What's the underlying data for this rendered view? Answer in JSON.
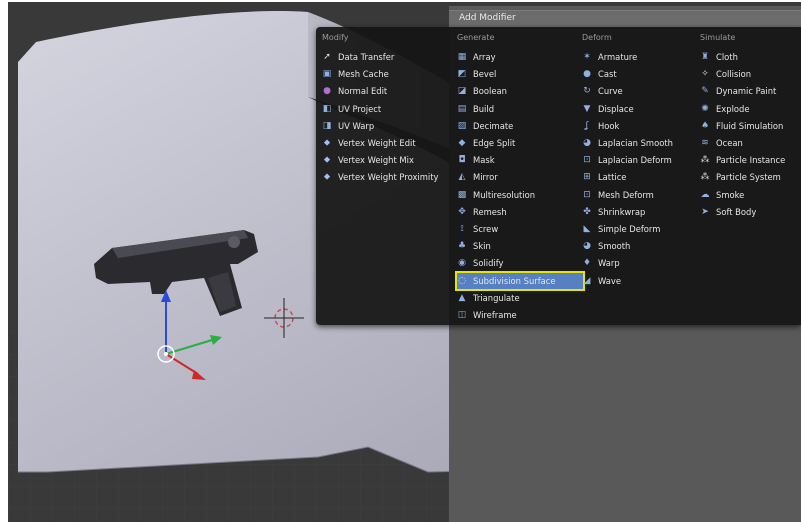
{
  "menu": {
    "title": "Add Modifier",
    "columns": [
      {
        "heading": "Modify",
        "items": [
          {
            "label": "Data Transfer",
            "icon": "data-transfer-icon",
            "glyph": "➚",
            "color": "#e0e0e0"
          },
          {
            "label": "Mesh Cache",
            "icon": "mesh-cache-icon",
            "glyph": "▣",
            "color": "#8fb0e0"
          },
          {
            "label": "Normal Edit",
            "icon": "normal-edit-icon",
            "glyph": "●",
            "color": "#b070d0"
          },
          {
            "label": "UV Project",
            "icon": "uv-project-icon",
            "glyph": "◧",
            "color": "#8fb0e0"
          },
          {
            "label": "UV Warp",
            "icon": "uv-warp-icon",
            "glyph": "◨",
            "color": "#8fb0e0"
          },
          {
            "label": "Vertex Weight Edit",
            "icon": "vertex-weight-edit-icon",
            "glyph": "⬥",
            "color": "#a0c0f0"
          },
          {
            "label": "Vertex Weight Mix",
            "icon": "vertex-weight-mix-icon",
            "glyph": "⬥",
            "color": "#a0c0f0"
          },
          {
            "label": "Vertex Weight Proximity",
            "icon": "vertex-weight-proximity-icon",
            "glyph": "⬥",
            "color": "#a0c0f0"
          }
        ]
      },
      {
        "heading": "Generate",
        "items": [
          {
            "label": "Array",
            "icon": "array-icon",
            "glyph": "▦",
            "color": "#8fb0e0"
          },
          {
            "label": "Bevel",
            "icon": "bevel-icon",
            "glyph": "◩",
            "color": "#8fb0e0"
          },
          {
            "label": "Boolean",
            "icon": "boolean-icon",
            "glyph": "◪",
            "color": "#8fb0e0"
          },
          {
            "label": "Build",
            "icon": "build-icon",
            "glyph": "▤",
            "color": "#8fb0e0"
          },
          {
            "label": "Decimate",
            "icon": "decimate-icon",
            "glyph": "▨",
            "color": "#8fb0e0"
          },
          {
            "label": "Edge Split",
            "icon": "edge-split-icon",
            "glyph": "◆",
            "color": "#8fb0e0"
          },
          {
            "label": "Mask",
            "icon": "mask-icon",
            "glyph": "◘",
            "color": "#8fb0e0"
          },
          {
            "label": "Mirror",
            "icon": "mirror-icon",
            "glyph": "◭",
            "color": "#8fb0e0"
          },
          {
            "label": "Multiresolution",
            "icon": "multiresolution-icon",
            "glyph": "▩",
            "color": "#8fb0e0"
          },
          {
            "label": "Remesh",
            "icon": "remesh-icon",
            "glyph": "✥",
            "color": "#8fb0e0"
          },
          {
            "label": "Screw",
            "icon": "screw-icon",
            "glyph": "⟟",
            "color": "#8fb0e0"
          },
          {
            "label": "Skin",
            "icon": "skin-icon",
            "glyph": "♣",
            "color": "#8fb0e0"
          },
          {
            "label": "Solidify",
            "icon": "solidify-icon",
            "glyph": "◉",
            "color": "#8fb0e0"
          },
          {
            "label": "Subdivision Surface",
            "icon": "subdivision-surface-icon",
            "glyph": "◌",
            "color": "#e0e0e0",
            "highlighted": true
          },
          {
            "label": "Triangulate",
            "icon": "triangulate-icon",
            "glyph": "▲",
            "color": "#8fb0e0"
          },
          {
            "label": "Wireframe",
            "icon": "wireframe-icon",
            "glyph": "◫",
            "color": "#8fb0e0"
          }
        ]
      },
      {
        "heading": "Deform",
        "items": [
          {
            "label": "Armature",
            "icon": "armature-icon",
            "glyph": "✶",
            "color": "#8fb0e0"
          },
          {
            "label": "Cast",
            "icon": "cast-icon",
            "glyph": "●",
            "color": "#8fb0e0"
          },
          {
            "label": "Curve",
            "icon": "curve-icon",
            "glyph": "↻",
            "color": "#8fb0e0"
          },
          {
            "label": "Displace",
            "icon": "displace-icon",
            "glyph": "▼",
            "color": "#8fb0e0"
          },
          {
            "label": "Hook",
            "icon": "hook-icon",
            "glyph": "ʆ",
            "color": "#8fb0e0"
          },
          {
            "label": "Laplacian Smooth",
            "icon": "laplacian-smooth-icon",
            "glyph": "◕",
            "color": "#8fb0e0"
          },
          {
            "label": "Laplacian Deform",
            "icon": "laplacian-deform-icon",
            "glyph": "⊡",
            "color": "#8fb0e0"
          },
          {
            "label": "Lattice",
            "icon": "lattice-icon",
            "glyph": "⊞",
            "color": "#8fb0e0"
          },
          {
            "label": "Mesh Deform",
            "icon": "mesh-deform-icon",
            "glyph": "⊡",
            "color": "#8fb0e0"
          },
          {
            "label": "Shrinkwrap",
            "icon": "shrinkwrap-icon",
            "glyph": "✤",
            "color": "#8fb0e0"
          },
          {
            "label": "Simple Deform",
            "icon": "simple-deform-icon",
            "glyph": "◣",
            "color": "#8fb0e0"
          },
          {
            "label": "Smooth",
            "icon": "smooth-icon",
            "glyph": "◕",
            "color": "#8fb0e0"
          },
          {
            "label": "Warp",
            "icon": "warp-icon",
            "glyph": "♦",
            "color": "#8fb0e0"
          },
          {
            "label": "Wave",
            "icon": "wave-icon",
            "glyph": "◢",
            "color": "#8fb0e0"
          }
        ]
      },
      {
        "heading": "Simulate",
        "items": [
          {
            "label": "Cloth",
            "icon": "cloth-icon",
            "glyph": "♜",
            "color": "#8fb0e0"
          },
          {
            "label": "Collision",
            "icon": "collision-icon",
            "glyph": "✧",
            "color": "#e0e0e0"
          },
          {
            "label": "Dynamic Paint",
            "icon": "dynamic-paint-icon",
            "glyph": "✎",
            "color": "#8fb0e0"
          },
          {
            "label": "Explode",
            "icon": "explode-icon",
            "glyph": "✺",
            "color": "#8fb0e0"
          },
          {
            "label": "Fluid Simulation",
            "icon": "fluid-simulation-icon",
            "glyph": "♠",
            "color": "#8fb0e0"
          },
          {
            "label": "Ocean",
            "icon": "ocean-icon",
            "glyph": "≋",
            "color": "#8fb0e0"
          },
          {
            "label": "Particle Instance",
            "icon": "particle-instance-icon",
            "glyph": "⁂",
            "color": "#e0e0e0"
          },
          {
            "label": "Particle System",
            "icon": "particle-system-icon",
            "glyph": "⁂",
            "color": "#e0e0e0"
          },
          {
            "label": "Smoke",
            "icon": "smoke-icon",
            "glyph": "☁",
            "color": "#8fb0e0"
          },
          {
            "label": "Soft Body",
            "icon": "soft-body-icon",
            "glyph": "➤",
            "color": "#8fb0e0"
          }
        ]
      }
    ]
  },
  "colors": {
    "highlight": "#5680c2",
    "highlight_outline": "#e6e600",
    "menu_bg": "#141414",
    "viewport_bg": "#3a3a3a"
  }
}
